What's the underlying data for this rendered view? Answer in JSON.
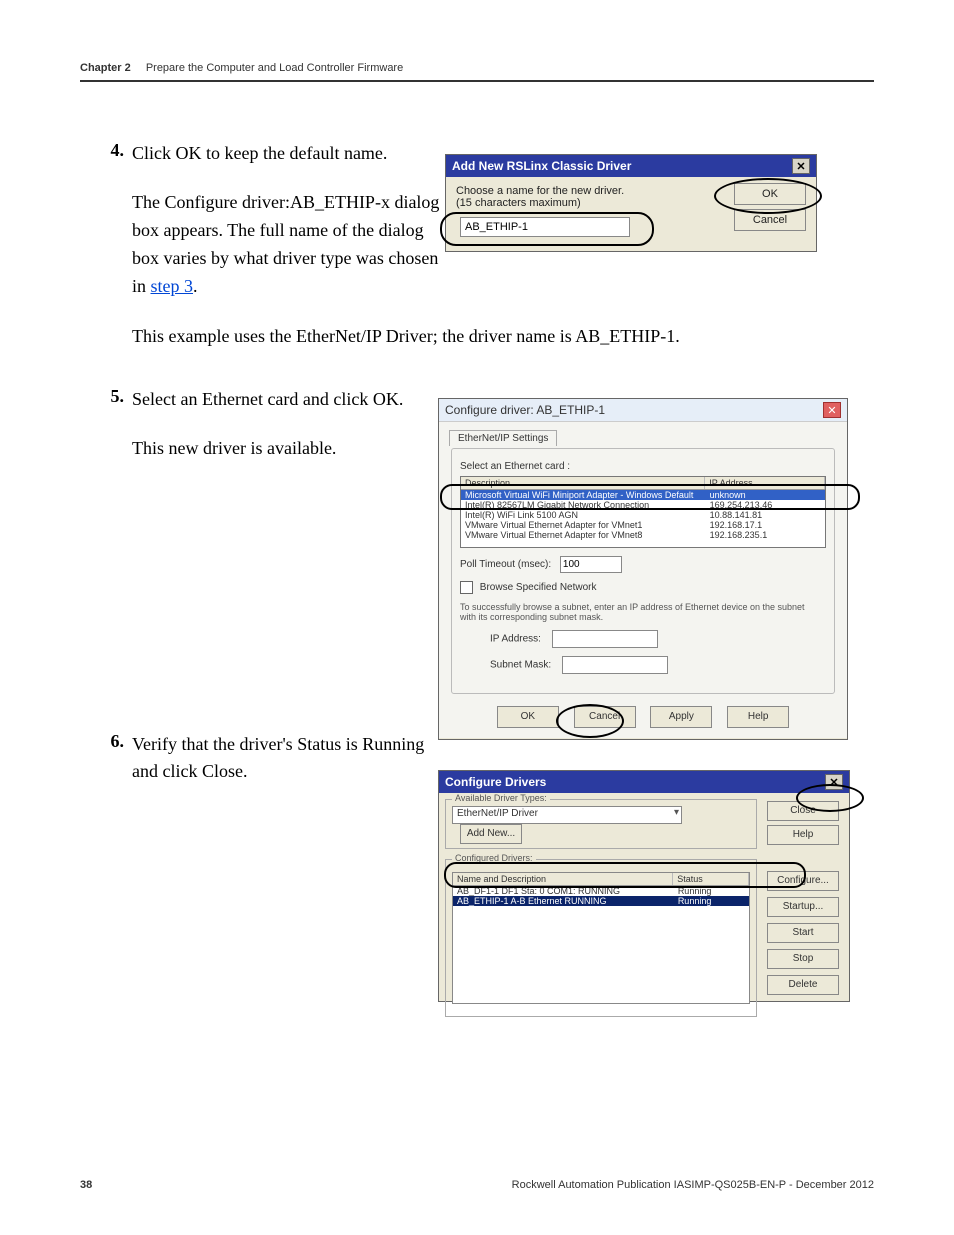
{
  "header": {
    "chapter": "Chapter 2",
    "title": "Prepare the Computer and Load Controller Firmware"
  },
  "steps": {
    "s4": {
      "num": "4.",
      "text": "Click OK to keep the default name."
    },
    "s4b": "The Configure driver:AB_ETHIP-x dialog box appears. The full name of the dialog box varies by what driver type was chosen in ",
    "s4b_link": "step 3",
    "s4b_after": ".",
    "s4c": "This example uses the EtherNet/IP Driver; the driver name is AB_ETHIP-1.",
    "s5": {
      "num": "5.",
      "text": "Select an Ethernet card and click OK."
    },
    "s5b": "This new driver is available.",
    "s6": {
      "num": "6.",
      "text": "Verify that the driver's Status is Running and click Close."
    }
  },
  "dialog_add": {
    "title": "Add New RSLinx Classic Driver",
    "prompt1": "Choose a name for the new driver.",
    "prompt2": "(15 characters maximum)",
    "value": "AB_ETHIP-1",
    "ok": "OK",
    "cancel": "Cancel"
  },
  "dialog_cfg": {
    "title": "Configure driver: AB_ETHIP-1",
    "tab": "EtherNet/IP Settings",
    "select_label": "Select an Ethernet card :",
    "head_desc": "Description",
    "head_ip": "IP Address",
    "rows": [
      {
        "desc": "Microsoft Virtual WiFi Miniport Adapter - Windows Default",
        "ip": "unknown",
        "sel": true
      },
      {
        "desc": "Intel(R) 82567LM Gigabit Network Connection",
        "ip": "169.254.213.46"
      },
      {
        "desc": "Intel(R) WiFi Link 5100 AGN",
        "ip": "10.88.141.81"
      },
      {
        "desc": "VMware Virtual Ethernet Adapter for VMnet1",
        "ip": "192.168.17.1"
      },
      {
        "desc": "VMware Virtual Ethernet Adapter for VMnet8",
        "ip": "192.168.235.1"
      }
    ],
    "poll_label": "Poll Timeout (msec):",
    "poll_value": "100",
    "browse_label": "Browse Specified Network",
    "subnet_help": "To successfully browse a subnet, enter an IP address of Ethernet device on the subnet with its corresponding subnet mask.",
    "ip_label": "IP Address:",
    "mask_label": "Subnet Mask:",
    "ok": "OK",
    "cancel": "Cancel",
    "apply": "Apply",
    "help": "Help"
  },
  "dialog_drv": {
    "title": "Configure Drivers",
    "avail": "Available Driver Types:",
    "combo": "EtherNet/IP Driver",
    "addnew": "Add New...",
    "close": "Close",
    "help": "Help",
    "configured": "Configured Drivers:",
    "head_name": "Name and Description",
    "head_status": "Status",
    "rows": [
      {
        "name": "AB_DF1-1 DF1 Sta: 0 COM1: RUNNING",
        "status": "Running"
      },
      {
        "name": "AB_ETHIP-1 A-B Ethernet RUNNING",
        "status": "Running",
        "sel": true
      }
    ],
    "btns": {
      "configure": "Configure...",
      "startup": "Startup...",
      "start": "Start",
      "stop": "Stop",
      "delete": "Delete"
    }
  },
  "footer": {
    "page": "38",
    "pub": "Rockwell Automation Publication IASIMP-QS025B-EN-P - December 2012"
  }
}
